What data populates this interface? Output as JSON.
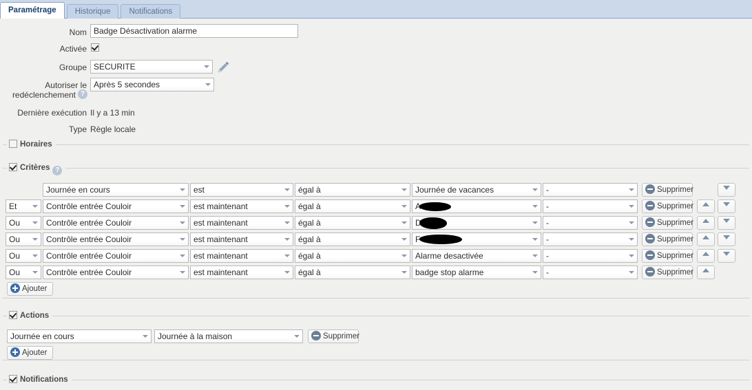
{
  "tabs": [
    {
      "label": "Paramétrage",
      "active": true
    },
    {
      "label": "Historique",
      "active": false
    },
    {
      "label": "Notifications",
      "active": false
    }
  ],
  "form": {
    "nom_label": "Nom",
    "nom_value": "Badge Désactivation alarme",
    "activee_label": "Activée",
    "activee_checked": true,
    "groupe_label": "Groupe",
    "groupe_value": "SECURITE",
    "redecl_label_l1": "Autoriser le",
    "redecl_label_l2": "redéclenchement",
    "redecl_value": "Après 5 secondes",
    "derniere_label": "Dernière exécution",
    "derniere_value": "Il y a 13 min",
    "type_label": "Type",
    "type_value": "Règle locale"
  },
  "sections": {
    "horaires": {
      "label": "Horaires",
      "checked": false
    },
    "criteres": {
      "label": "Critères",
      "checked": true,
      "help": "?"
    },
    "actions": {
      "label": "Actions",
      "checked": true
    },
    "notifications": {
      "label": "Notifications",
      "checked": true
    }
  },
  "criteria": {
    "add_label": "Ajouter",
    "delete_label": "Supprimer",
    "rows": [
      {
        "logic": "",
        "has_logic": false,
        "subject": "Journée en cours",
        "verb": "est",
        "operator": "égal à",
        "value": "Journée de vacances",
        "value_redacted": false,
        "extra": "-",
        "up": false,
        "down": true
      },
      {
        "logic": "Et",
        "has_logic": true,
        "subject": "Contrôle entrée Couloir",
        "verb": "est maintenant",
        "operator": "égal à",
        "value": "A",
        "value_redacted": true,
        "extra": "-",
        "up": true,
        "down": true
      },
      {
        "logic": "Ou",
        "has_logic": true,
        "subject": "Contrôle entrée Couloir",
        "verb": "est maintenant",
        "operator": "égal à",
        "value": "D",
        "value_redacted": true,
        "extra": "-",
        "up": true,
        "down": true
      },
      {
        "logic": "Ou",
        "has_logic": true,
        "subject": "Contrôle entrée Couloir",
        "verb": "est maintenant",
        "operator": "égal à",
        "value": "F",
        "value_redacted": true,
        "extra": "-",
        "up": true,
        "down": true
      },
      {
        "logic": "Ou",
        "has_logic": true,
        "subject": "Contrôle entrée Couloir",
        "verb": "est maintenant",
        "operator": "égal à",
        "value": "Alarme desactivée",
        "value_redacted": false,
        "extra": "-",
        "up": true,
        "down": true
      },
      {
        "logic": "Ou",
        "has_logic": true,
        "subject": "Contrôle entrée Couloir",
        "verb": "est maintenant",
        "operator": "égal à",
        "value": "badge stop alarme",
        "value_redacted": false,
        "extra": "-",
        "up": true,
        "down": false
      }
    ]
  },
  "actions": {
    "add_label": "Ajouter",
    "delete_label": "Supprimer",
    "rows": [
      {
        "target": "Journée en cours",
        "value": "Journée à la maison"
      }
    ]
  },
  "colors": {
    "tabbar": "#ccd9ea",
    "page_bg": "#f0f0ef",
    "accent": "#16406e",
    "icon_blue": "#3d6ea8",
    "icon_grey_blue": "#6b7f96"
  }
}
